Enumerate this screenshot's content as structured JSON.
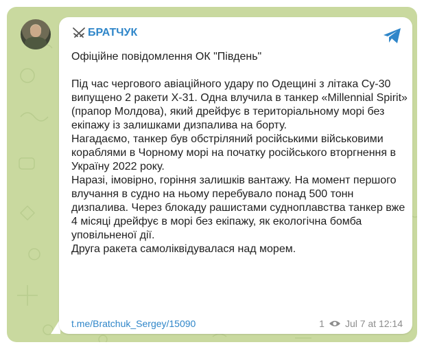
{
  "post": {
    "channel_name": "БРАТЧУК",
    "paragraphs": [
      "Офіційне повідомлення ОК \"Південь\"",
      "Під час чергового авіаційного удару по Одещині з літака Су-30 випущено 2 ракети Х-31. Одна влучила в танкер «Millennial Spirit» (прапор Молдова), який дрейфує в територіальному морі без екіпажу із залишками дизпалива на борту.\nНагадаємо, танкер був обстріляний російськими військовими кораблями в Чорному морі на початку російського вторгнення в Україну 2022 року.\nНаразі, імовірно, горіння залишків вантажу. На момент першого влучання в судно на ньому перебувало понад 500 тонн дизпалива. Через блокаду рашистами судноплавства танкер вже 4 місяці дрейфує в морі без екіпажу, як екологічна бомба уповільненої дії.\nДруга ракета самоліквідувалася над морем."
    ],
    "link": "t.me/Bratchuk_Sergey/15090",
    "views": "1",
    "timestamp": "Jul 7 at 12:14"
  },
  "icons": {
    "channel_badge": "crossed-swords-icon",
    "share": "telegram-icon",
    "views": "eye-icon"
  },
  "colors": {
    "accent": "#2f86c9",
    "background_pattern": "#c9d99f",
    "bubble": "#ffffff"
  }
}
